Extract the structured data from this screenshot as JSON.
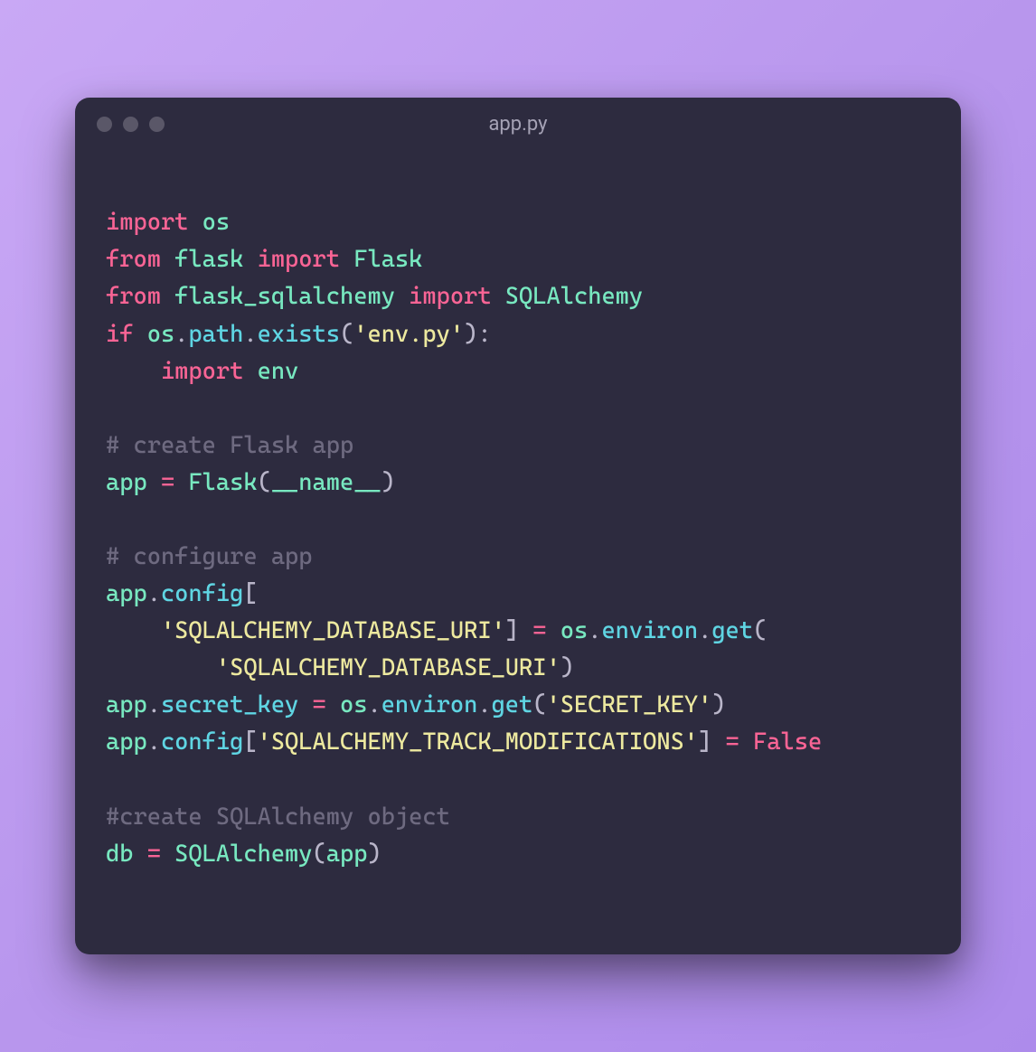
{
  "window": {
    "title": "app.py"
  },
  "code": {
    "lines": [
      [
        {
          "cls": "kw",
          "t": "import"
        },
        {
          "cls": "",
          "t": " "
        },
        {
          "cls": "ident",
          "t": "os"
        }
      ],
      [
        {
          "cls": "kw",
          "t": "from"
        },
        {
          "cls": "",
          "t": " "
        },
        {
          "cls": "ident",
          "t": "flask"
        },
        {
          "cls": "",
          "t": " "
        },
        {
          "cls": "kw",
          "t": "import"
        },
        {
          "cls": "",
          "t": " "
        },
        {
          "cls": "ident",
          "t": "Flask"
        }
      ],
      [
        {
          "cls": "kw",
          "t": "from"
        },
        {
          "cls": "",
          "t": " "
        },
        {
          "cls": "ident",
          "t": "flask_sqlalchemy"
        },
        {
          "cls": "",
          "t": " "
        },
        {
          "cls": "kw",
          "t": "import"
        },
        {
          "cls": "",
          "t": " "
        },
        {
          "cls": "ident",
          "t": "SQLAlchemy"
        }
      ],
      [
        {
          "cls": "kw",
          "t": "if"
        },
        {
          "cls": "",
          "t": " "
        },
        {
          "cls": "ident",
          "t": "os"
        },
        {
          "cls": "punct",
          "t": "."
        },
        {
          "cls": "attr",
          "t": "path"
        },
        {
          "cls": "punct",
          "t": "."
        },
        {
          "cls": "call",
          "t": "exists"
        },
        {
          "cls": "punct",
          "t": "("
        },
        {
          "cls": "str",
          "t": "'env.py'"
        },
        {
          "cls": "punct",
          "t": "):"
        }
      ],
      [
        {
          "cls": "",
          "t": "    "
        },
        {
          "cls": "kw",
          "t": "import"
        },
        {
          "cls": "",
          "t": " "
        },
        {
          "cls": "ident",
          "t": "env"
        }
      ],
      [],
      [
        {
          "cls": "comment",
          "t": "# create Flask app"
        }
      ],
      [
        {
          "cls": "ident",
          "t": "app"
        },
        {
          "cls": "",
          "t": " "
        },
        {
          "cls": "op",
          "t": "="
        },
        {
          "cls": "",
          "t": " "
        },
        {
          "cls": "ident",
          "t": "Flask"
        },
        {
          "cls": "punct",
          "t": "("
        },
        {
          "cls": "ident",
          "t": "__name__"
        },
        {
          "cls": "punct",
          "t": ")"
        }
      ],
      [],
      [
        {
          "cls": "comment",
          "t": "# configure app"
        }
      ],
      [
        {
          "cls": "ident",
          "t": "app"
        },
        {
          "cls": "punct",
          "t": "."
        },
        {
          "cls": "attr",
          "t": "config"
        },
        {
          "cls": "punct",
          "t": "["
        }
      ],
      [
        {
          "cls": "",
          "t": "    "
        },
        {
          "cls": "str",
          "t": "'SQLALCHEMY_DATABASE_URI'"
        },
        {
          "cls": "punct",
          "t": "] "
        },
        {
          "cls": "op",
          "t": "="
        },
        {
          "cls": "",
          "t": " "
        },
        {
          "cls": "ident",
          "t": "os"
        },
        {
          "cls": "punct",
          "t": "."
        },
        {
          "cls": "attr",
          "t": "environ"
        },
        {
          "cls": "punct",
          "t": "."
        },
        {
          "cls": "call",
          "t": "get"
        },
        {
          "cls": "punct",
          "t": "("
        }
      ],
      [
        {
          "cls": "",
          "t": "        "
        },
        {
          "cls": "str",
          "t": "'SQLALCHEMY_DATABASE_URI'"
        },
        {
          "cls": "punct",
          "t": ")"
        }
      ],
      [
        {
          "cls": "ident",
          "t": "app"
        },
        {
          "cls": "punct",
          "t": "."
        },
        {
          "cls": "attr",
          "t": "secret_key"
        },
        {
          "cls": "",
          "t": " "
        },
        {
          "cls": "op",
          "t": "="
        },
        {
          "cls": "",
          "t": " "
        },
        {
          "cls": "ident",
          "t": "os"
        },
        {
          "cls": "punct",
          "t": "."
        },
        {
          "cls": "attr",
          "t": "environ"
        },
        {
          "cls": "punct",
          "t": "."
        },
        {
          "cls": "call",
          "t": "get"
        },
        {
          "cls": "punct",
          "t": "("
        },
        {
          "cls": "str",
          "t": "'SECRET_KEY'"
        },
        {
          "cls": "punct",
          "t": ")"
        }
      ],
      [
        {
          "cls": "ident",
          "t": "app"
        },
        {
          "cls": "punct",
          "t": "."
        },
        {
          "cls": "attr",
          "t": "config"
        },
        {
          "cls": "punct",
          "t": "["
        },
        {
          "cls": "str",
          "t": "'SQLALCHEMY_TRACK_MODIFICATIONS'"
        },
        {
          "cls": "punct",
          "t": "] "
        },
        {
          "cls": "op",
          "t": "="
        },
        {
          "cls": "",
          "t": " "
        },
        {
          "cls": "boolval",
          "t": "False"
        }
      ],
      [],
      [
        {
          "cls": "comment",
          "t": "#create SQLAlchemy object"
        }
      ],
      [
        {
          "cls": "ident",
          "t": "db"
        },
        {
          "cls": "",
          "t": " "
        },
        {
          "cls": "op",
          "t": "="
        },
        {
          "cls": "",
          "t": " "
        },
        {
          "cls": "ident",
          "t": "SQLAlchemy"
        },
        {
          "cls": "punct",
          "t": "("
        },
        {
          "cls": "ident",
          "t": "app"
        },
        {
          "cls": "punct",
          "t": ")"
        }
      ]
    ]
  }
}
